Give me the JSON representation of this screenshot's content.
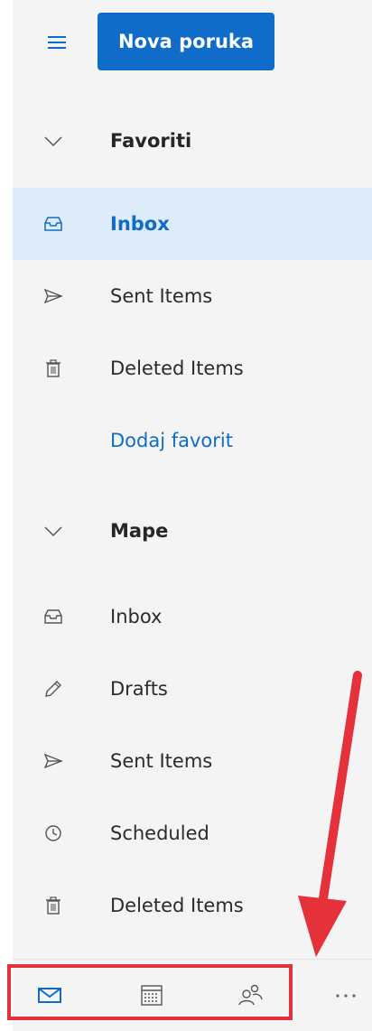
{
  "header": {
    "new_message_label": "Nova poruka"
  },
  "favorites": {
    "title": "Favoriti",
    "items": [
      {
        "label": "Inbox",
        "icon": "inbox-icon",
        "selected": true
      },
      {
        "label": "Sent Items",
        "icon": "send-icon"
      },
      {
        "label": "Deleted Items",
        "icon": "trash-icon"
      }
    ],
    "add_favorite_label": "Dodaj favorit"
  },
  "folders": {
    "title": "Mape",
    "items": [
      {
        "label": "Inbox",
        "icon": "inbox-icon"
      },
      {
        "label": "Drafts",
        "icon": "pencil-icon"
      },
      {
        "label": "Sent Items",
        "icon": "send-icon"
      },
      {
        "label": "Scheduled",
        "icon": "clock-icon"
      },
      {
        "label": "Deleted Items",
        "icon": "trash-icon"
      }
    ]
  },
  "bottom_bar": {
    "items": [
      {
        "icon": "mail-icon",
        "active": true
      },
      {
        "icon": "calendar-icon"
      },
      {
        "icon": "people-icon"
      },
      {
        "icon": "more-icon"
      }
    ]
  },
  "colors": {
    "accent": "#0f6cc9",
    "selected_bg": "#deecf9",
    "pane_bg": "#f4f4f4",
    "annotation": "#e5313a"
  }
}
